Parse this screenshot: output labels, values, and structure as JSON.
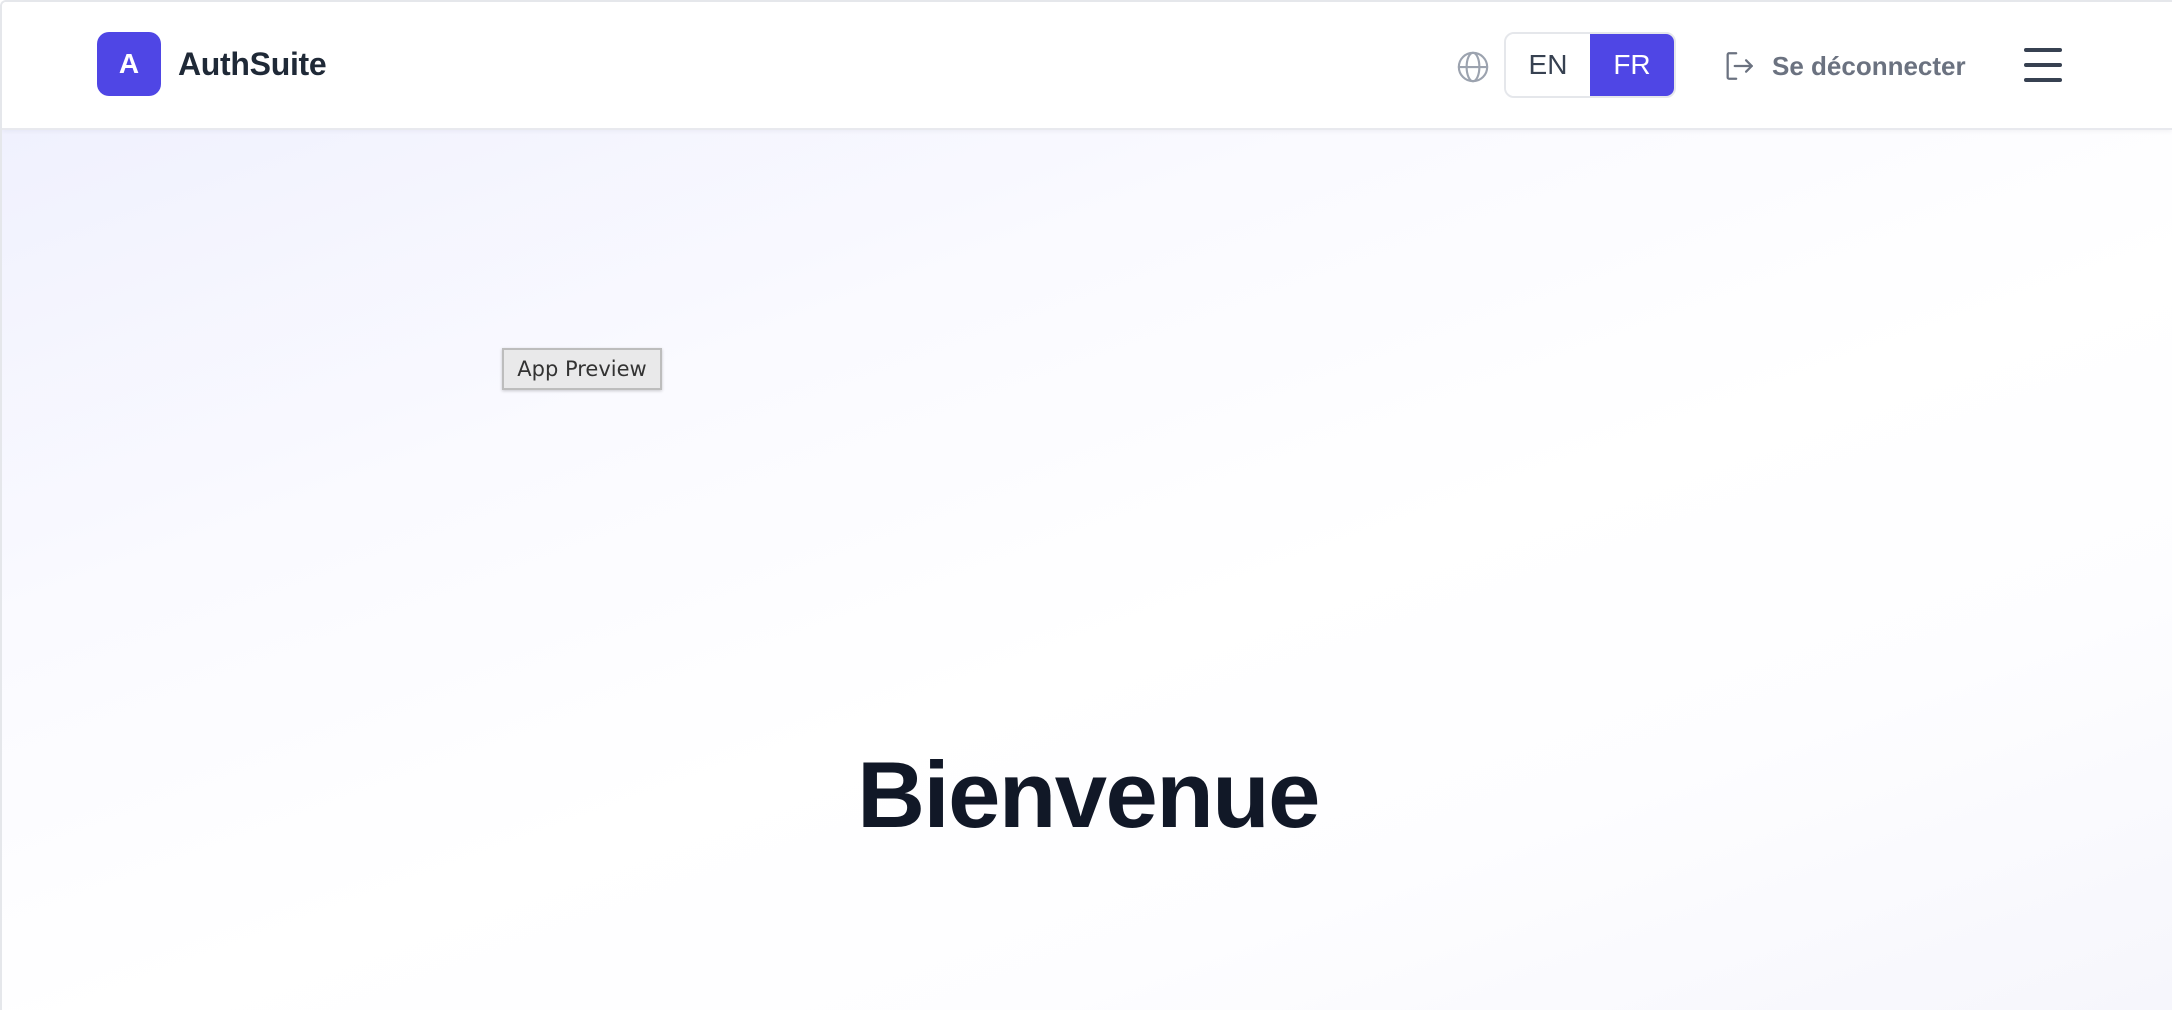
{
  "brand": {
    "logo_letter": "A",
    "name": "AuthSuite",
    "accent_color": "#4f46e5"
  },
  "header": {
    "globe_icon": "globe-icon",
    "languages": [
      {
        "code": "EN",
        "active": false
      },
      {
        "code": "FR",
        "active": true
      }
    ],
    "logout": {
      "icon": "logout-icon",
      "label": "Se déconnecter"
    },
    "menu_icon": "hamburger-menu-icon"
  },
  "main": {
    "app_preview_label": "App Preview",
    "hero_title": "Bienvenue"
  }
}
